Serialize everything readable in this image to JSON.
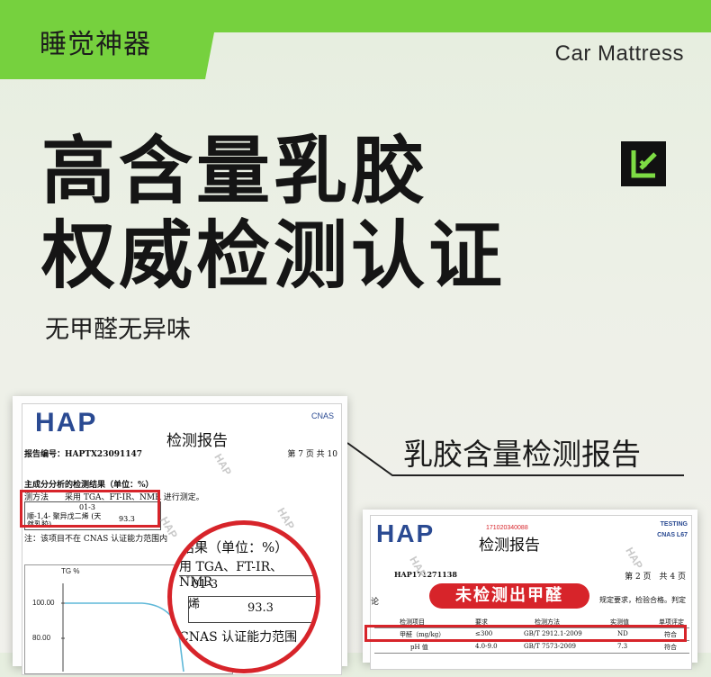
{
  "header": {
    "brand": "睡觉神器",
    "english": "Car Mattress"
  },
  "hero": {
    "title_line1": "高含量乳胶",
    "title_line2": "权威检测认证",
    "subtitle": "无甲醛无异味"
  },
  "callout": {
    "label": "乳胶含量检测报告"
  },
  "report_left": {
    "logo_text": "HAP",
    "cnas": "CNAS",
    "title": "检测报告",
    "report_no": "报告编号：HAPTX23091147",
    "page": "第 7 页 共 10",
    "section": "主成分分析的检测结果（单位：%）",
    "method": "测方法　　采用 TGA、FT-IR、NMR 进行测定。",
    "sample": "01-3",
    "component": "顺-1,4- 聚异戊二烯 (天然乳胶)",
    "value": "93.3",
    "note": "注：该项目不在 CNAS 认证能力范围内",
    "chart_tg": "TG %",
    "tick_100": "100.00",
    "tick_80": "80.00"
  },
  "magnifier": {
    "title": "结果（单位：%）",
    "method": "用 TGA、FT-IR、NMR",
    "sample": "01-3",
    "component": "烯",
    "value": "93.3",
    "note": "CNAS 认证能力范围"
  },
  "report_right": {
    "logo_text": "HAP",
    "code": "171020340088",
    "testing": "TESTING",
    "cnas": "CNAS L67",
    "title": "检测报告",
    "report_no": "HAP171271138",
    "page": "第 2 页　共 4 页",
    "left_text": "论",
    "right_text": "规定要求，检验合格。判定",
    "badge": "未检测出甲醛",
    "table_header": [
      "检测项目",
      "要求",
      "检测方法",
      "实测值",
      "单项评定"
    ],
    "row1": [
      "甲醛（mg/kg）",
      "≤300",
      "GB/T 2912.1-2009",
      "ND",
      "符合"
    ],
    "row2": [
      "pH 值",
      "4.0-9.0",
      "GB/T 7573-2009",
      "7.3",
      "符合"
    ]
  }
}
